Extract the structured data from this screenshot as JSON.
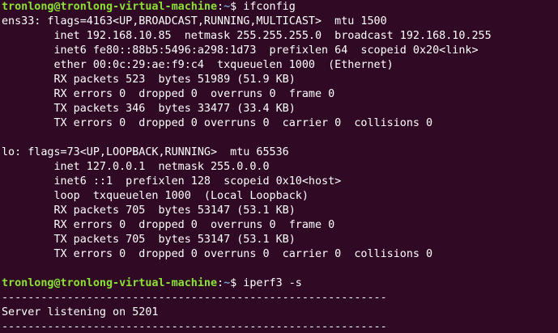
{
  "colors": {
    "background": "#300a24",
    "foreground": "#ffffff",
    "prompt_user": "#8ae234",
    "prompt_path": "#729fcf"
  },
  "session": [
    {
      "type": "prompt",
      "user_host": "tronlong@tronlong-virtual-machine",
      "sep": ":",
      "path": "~",
      "dollar": "$ ",
      "command": "ifconfig"
    },
    {
      "type": "output",
      "text": "ens33: flags=4163<UP,BROADCAST,RUNNING,MULTICAST>  mtu 1500"
    },
    {
      "type": "output",
      "text": "        inet 192.168.10.85  netmask 255.255.255.0  broadcast 192.168.10.255"
    },
    {
      "type": "output",
      "text": "        inet6 fe80::88b5:5496:a298:1d73  prefixlen 64  scopeid 0x20<link>"
    },
    {
      "type": "output",
      "text": "        ether 00:0c:29:ae:f9:c4  txqueuelen 1000  (Ethernet)"
    },
    {
      "type": "output",
      "text": "        RX packets 523  bytes 51989 (51.9 KB)"
    },
    {
      "type": "output",
      "text": "        RX errors 0  dropped 0  overruns 0  frame 0"
    },
    {
      "type": "output",
      "text": "        TX packets 346  bytes 33477 (33.4 KB)"
    },
    {
      "type": "output",
      "text": "        TX errors 0  dropped 0 overruns 0  carrier 0  collisions 0"
    },
    {
      "type": "output",
      "text": ""
    },
    {
      "type": "output",
      "text": "lo: flags=73<UP,LOOPBACK,RUNNING>  mtu 65536"
    },
    {
      "type": "output",
      "text": "        inet 127.0.0.1  netmask 255.0.0.0"
    },
    {
      "type": "output",
      "text": "        inet6 ::1  prefixlen 128  scopeid 0x10<host>"
    },
    {
      "type": "output",
      "text": "        loop  txqueuelen 1000  (Local Loopback)"
    },
    {
      "type": "output",
      "text": "        RX packets 705  bytes 53147 (53.1 KB)"
    },
    {
      "type": "output",
      "text": "        RX errors 0  dropped 0  overruns 0  frame 0"
    },
    {
      "type": "output",
      "text": "        TX packets 705  bytes 53147 (53.1 KB)"
    },
    {
      "type": "output",
      "text": "        TX errors 0  dropped 0 overruns 0  carrier 0  collisions 0"
    },
    {
      "type": "output",
      "text": ""
    },
    {
      "type": "prompt",
      "user_host": "tronlong@tronlong-virtual-machine",
      "sep": ":",
      "path": "~",
      "dollar": "$ ",
      "command": "iperf3 -s"
    },
    {
      "type": "output",
      "text": "-----------------------------------------------------------"
    },
    {
      "type": "output",
      "text": "Server listening on 5201"
    },
    {
      "type": "output",
      "text": "-----------------------------------------------------------"
    }
  ]
}
